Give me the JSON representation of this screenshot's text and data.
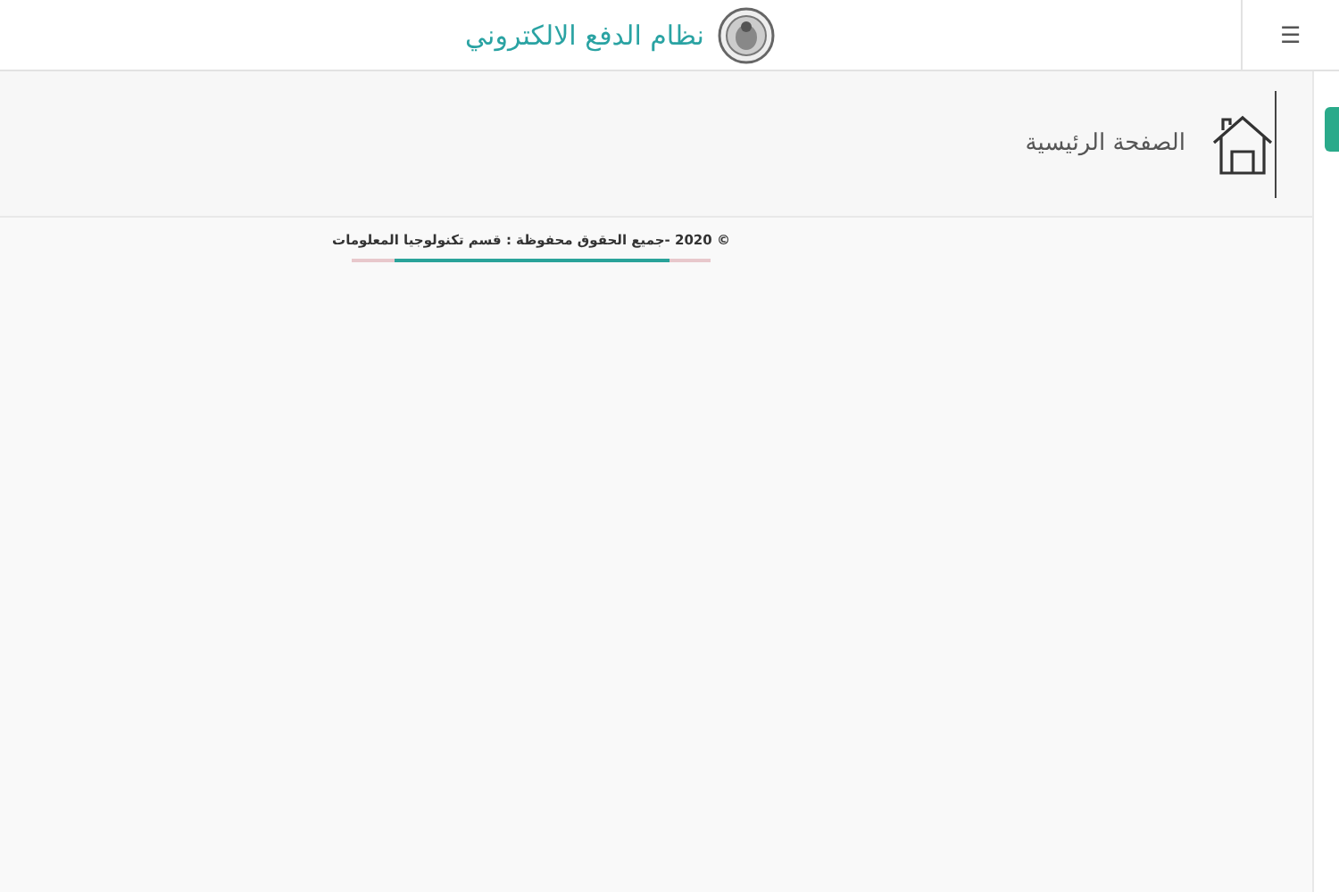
{
  "header": {
    "title": "نظام الدفع الالكتروني",
    "menu_icon": "☰"
  },
  "page_header": {
    "title": "الصفحة الرئيسية"
  },
  "footer": {
    "text": "© **2020** -جميع الحقوق محفوظة : قسم تكنولوجيا المعلومات"
  }
}
